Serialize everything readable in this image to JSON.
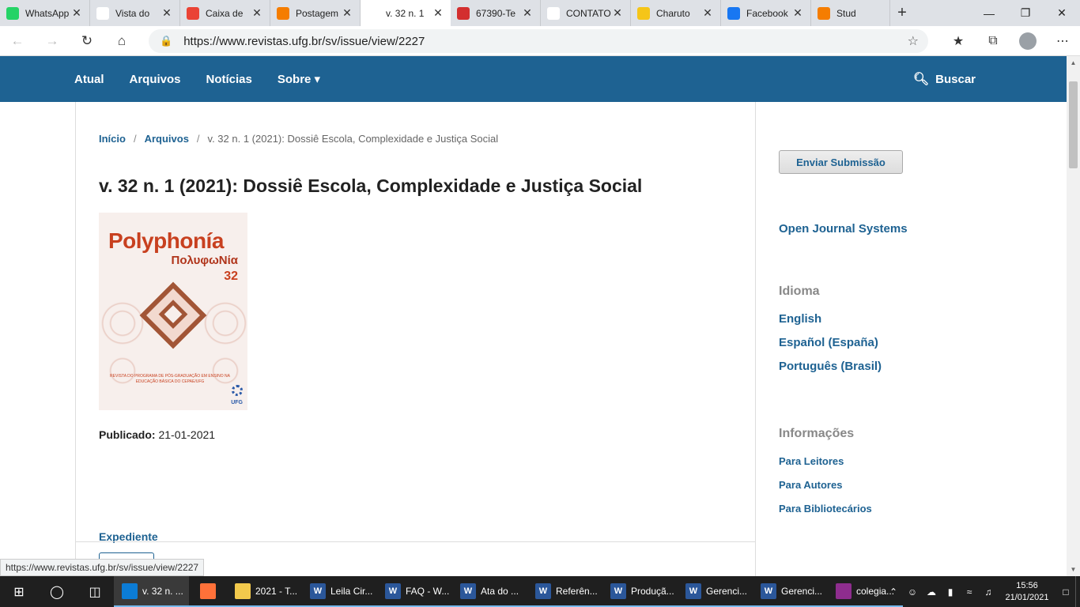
{
  "browser": {
    "tabs": [
      {
        "label": "WhatsApp",
        "icon": "whatsapp-icon",
        "color": "#25d366"
      },
      {
        "label": "Vista do",
        "icon": "pkp-icon",
        "color": "#ffffff"
      },
      {
        "label": "Caixa de",
        "icon": "gmail-icon",
        "color": "#ea4335"
      },
      {
        "label": "Postagem",
        "icon": "blogger-icon",
        "color": "#f57d00"
      },
      {
        "label": "v. 32 n. 1",
        "icon": "pkp-icon",
        "color": "#ffffff"
      },
      {
        "label": "67390-Te",
        "icon": "pdf-icon",
        "color": "#d32f2f"
      },
      {
        "label": "CONTATO",
        "icon": "document-icon",
        "color": "#ffffff"
      },
      {
        "label": "Charuto",
        "icon": "ts-icon",
        "color": "#f5c518"
      },
      {
        "label": "Facebook",
        "icon": "facebook-icon",
        "color": "#1877f2"
      },
      {
        "label": "Stud",
        "icon": "blogger-icon",
        "color": "#f57d00"
      }
    ],
    "url": "https://www.revistas.ufg.br/sv/issue/view/2227",
    "status_url": "https://www.revistas.ufg.br/sv/issue/view/2227"
  },
  "site": {
    "nav": [
      "Atual",
      "Arquivos",
      "Notícias",
      "Sobre ▾"
    ],
    "search_label": "Buscar"
  },
  "breadcrumb": {
    "home": "Início",
    "archives": "Arquivos",
    "current": "v. 32 n. 1 (2021): Dossiê Escola, Complexidade e Justiça Social"
  },
  "issue": {
    "title": "v. 32 n. 1 (2021): Dossiê Escola, Complexidade e Justiça Social",
    "cover": {
      "title": "Polyphonía",
      "greek": "ΠολυφωΝία",
      "number": "32",
      "footer": "REVISTA DO PROGRAMA DE PÓS-GRADUAÇÃO EM ENSINO NA EDUCAÇÃO BÁSICA DO CEPAE/UFG",
      "logo": "UFG"
    },
    "published_label": "Publicado:",
    "published_date": "21-01-2021",
    "section": "Expediente"
  },
  "sidebar": {
    "submit_button": "Enviar Submissão",
    "ojs_link": "Open Journal Systems",
    "language_heading": "Idioma",
    "languages": [
      "English",
      "Español (España)",
      "Português (Brasil)"
    ],
    "info_heading": "Informações",
    "info_links": [
      "Para Leitores",
      "Para Autores",
      "Para Bibliotecários"
    ]
  },
  "taskbar": {
    "apps": [
      {
        "label": "v. 32 n. ...",
        "icon": "edge-icon",
        "color": "#0c7cd5"
      },
      {
        "label": "",
        "icon": "firefox-icon",
        "color": "#ff7139"
      },
      {
        "label": "2021 - T...",
        "icon": "folder-icon",
        "color": "#f2c94c"
      },
      {
        "label": "Leila Cir...",
        "icon": "word-icon",
        "color": "#2b579a"
      },
      {
        "label": "FAQ - W...",
        "icon": "word-icon",
        "color": "#2b579a"
      },
      {
        "label": "Ata do ...",
        "icon": "word-icon",
        "color": "#2b579a"
      },
      {
        "label": "Referên...",
        "icon": "word-icon",
        "color": "#2b579a"
      },
      {
        "label": "Produçã...",
        "icon": "word-icon",
        "color": "#2b579a"
      },
      {
        "label": "Gerenci...",
        "icon": "word-icon",
        "color": "#2b579a"
      },
      {
        "label": "Gerenci...",
        "icon": "word-icon",
        "color": "#2b579a"
      },
      {
        "label": "colegia...",
        "icon": "winrar-icon",
        "color": "#8e2d8e"
      }
    ],
    "time": "15:56",
    "date": "21/01/2021"
  }
}
